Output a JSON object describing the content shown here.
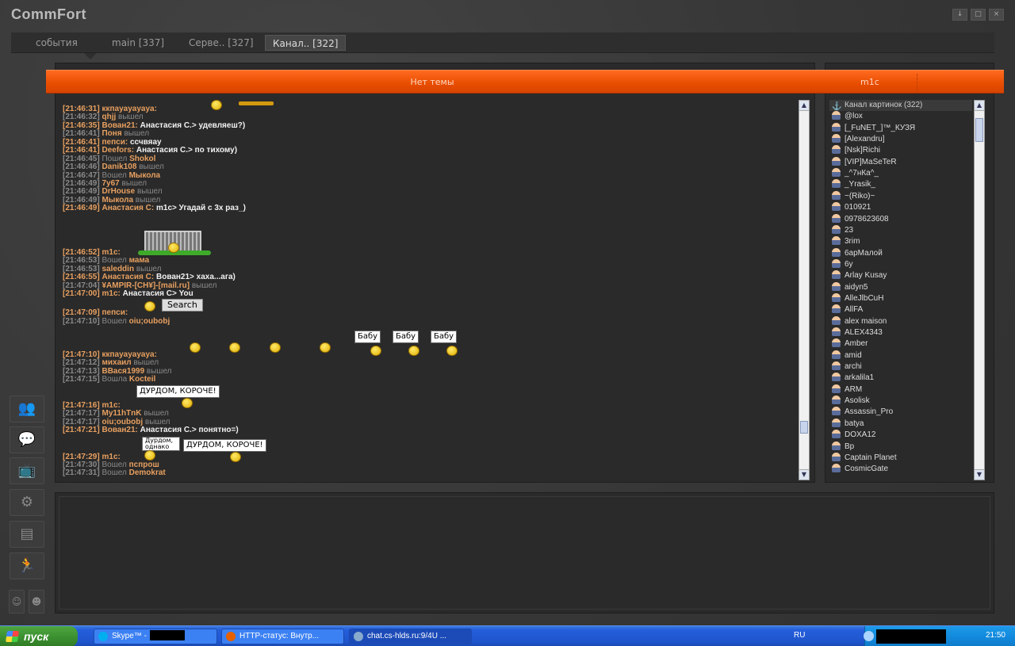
{
  "app": {
    "title": "CommFort"
  },
  "window_buttons": [
    "↓",
    "□",
    "×"
  ],
  "tabs": [
    {
      "label": "события"
    },
    {
      "label": "main [337]"
    },
    {
      "label": "Серве.. [327]"
    },
    {
      "label": "Канал.. [322]"
    }
  ],
  "header": {
    "topic": "Нет темы",
    "channel": "m1c"
  },
  "messages": [
    {
      "time": "[21:46:31]",
      "nick": "ккпаyayayaya:",
      "text": "",
      "sys": false
    },
    {
      "time": "[21:46:32]",
      "nick": "qhjj",
      "text": "вышел",
      "sys": true
    },
    {
      "time": "[21:46:35]",
      "nick": "Вован21:",
      "text": "Анастасия С.> удевляеш?)",
      "sys": false
    },
    {
      "time": "[21:46:41]",
      "nick": "Поня",
      "text": "вышел",
      "sys": true
    },
    {
      "time": "[21:46:41]",
      "nick": "пепси:",
      "text": "ссчвяау",
      "sys": false
    },
    {
      "time": "[21:46:41]",
      "nick": "Deefors:",
      "text": "Анастасия С.> по тихому)",
      "sys": false
    },
    {
      "time": "[21:46:45]",
      "nick": "Shokol",
      "text": "Пошел",
      "sys": true,
      "pre": true
    },
    {
      "time": "[21:46:46]",
      "nick": "Danik108",
      "text": "вышел",
      "sys": true
    },
    {
      "time": "[21:46:47]",
      "nick": "Мыкола",
      "text": "Вошел",
      "sys": true,
      "pre": true
    },
    {
      "time": "[21:46:49]",
      "nick": "7y67",
      "text": "вышел",
      "sys": true
    },
    {
      "time": "[21:46:49]",
      "nick": "DrHouse",
      "text": "вышел",
      "sys": true
    },
    {
      "time": "[21:46:49]",
      "nick": "Мыкола",
      "text": "вышел",
      "sys": true
    },
    {
      "time": "[21:46:49]",
      "nick": "Анастасия С:",
      "text": "m1c> Угадай с 3х раз_)",
      "sys": false
    },
    {
      "time": "[21:46:52]",
      "nick": "m1c:",
      "text": "",
      "sys": false
    },
    {
      "time": "[21:46:53]",
      "nick": "мама",
      "text": "Вошел",
      "sys": true,
      "pre": true
    },
    {
      "time": "[21:46:53]",
      "nick": "saleddin",
      "text": "вышел",
      "sys": true
    },
    {
      "time": "[21:46:55]",
      "nick": "Анастасия С:",
      "text": "Вован21> хаха...ага)",
      "sys": false
    },
    {
      "time": "[21:47:04]",
      "nick": "¥AMPIR-[CH¥]-[mail.ru]",
      "text": "вышел",
      "sys": true
    },
    {
      "time": "[21:47:00]",
      "nick": "m1c:",
      "text": "Анастасия С> You",
      "sys": false
    },
    {
      "time": "[21:47:09]",
      "nick": "пепси:",
      "text": "",
      "sys": false
    },
    {
      "time": "[21:47:10]",
      "nick": "oiu;oubobj",
      "text": "Вошел",
      "sys": true,
      "pre": true
    },
    {
      "time": "[21:47:10]",
      "nick": "ккпаyayayaya:",
      "text": "",
      "sys": false
    },
    {
      "time": "[21:47:12]",
      "nick": "михаил",
      "text": "вышел",
      "sys": true
    },
    {
      "time": "[21:47:13]",
      "nick": "ВВася1999",
      "text": "вышел",
      "sys": true
    },
    {
      "time": "[21:47:15]",
      "nick": "Kocteil",
      "text": "Вошла",
      "sys": true,
      "pre": true
    },
    {
      "time": "[21:47:16]",
      "nick": "m1c:",
      "text": "",
      "sys": false
    },
    {
      "time": "[21:47:17]",
      "nick": "My11hTnK",
      "text": "вышел",
      "sys": true
    },
    {
      "time": "[21:47:17]",
      "nick": "oiu;oubobj",
      "text": "вышел",
      "sys": true
    },
    {
      "time": "[21:47:21]",
      "nick": "Вован21:",
      "text": "Анастасия С.> понятно=)",
      "sys": false
    },
    {
      "time": "[21:47:29]",
      "nick": "m1c:",
      "text": "",
      "sys": false
    },
    {
      "time": "[21:47:30]",
      "nick": "пспрош",
      "text": "Вошел",
      "sys": true,
      "pre": true
    },
    {
      "time": "[21:47:31]",
      "nick": "Demokrat",
      "text": "Вошел",
      "sys": true,
      "pre": true
    }
  ],
  "inline": {
    "search": "Search",
    "sign_babu": "Бабу",
    "sign_durdom": "ДУРДОМ, КОРОЧЕ!",
    "sign_odnako": "Дурдом, однако"
  },
  "users": [
    {
      "name": "Канал картинок (322)",
      "chan": true
    },
    {
      "name": "@lox"
    },
    {
      "name": "[_FuNET_]™_КУЗЯ"
    },
    {
      "name": "[Alexandru]"
    },
    {
      "name": "[Nsk]Richi"
    },
    {
      "name": "[VIP]MaSeTeR"
    },
    {
      "name": "_^7нКа^_"
    },
    {
      "name": "_Yrasik_"
    },
    {
      "name": "~(Riko)~"
    },
    {
      "name": "010921"
    },
    {
      "name": "0978623608"
    },
    {
      "name": "23"
    },
    {
      "name": "3rim"
    },
    {
      "name": "6арМалой"
    },
    {
      "name": "6y"
    },
    {
      "name": "Arlay Kusay"
    },
    {
      "name": "aidyn5"
    },
    {
      "name": "AlleJlbCuH"
    },
    {
      "name": "AllFA"
    },
    {
      "name": "alex maison"
    },
    {
      "name": "ALEX4343"
    },
    {
      "name": "Amber"
    },
    {
      "name": "amid"
    },
    {
      "name": "archi"
    },
    {
      "name": "arkalila1"
    },
    {
      "name": "ARM"
    },
    {
      "name": "Asolisk"
    },
    {
      "name": "Assassin_Pro"
    },
    {
      "name": "batya"
    },
    {
      "name": "DOXA12"
    },
    {
      "name": "Bp"
    },
    {
      "name": "Captain Planet"
    },
    {
      "name": "CosmicGate"
    }
  ],
  "taskbar": {
    "start": "пуск",
    "tasks": [
      "Skype™ -",
      "HTTP-статус: Внутр...",
      "chat.cs-hlds.ru:9/4U ..."
    ],
    "lang": "RU",
    "clock": "21:50"
  }
}
